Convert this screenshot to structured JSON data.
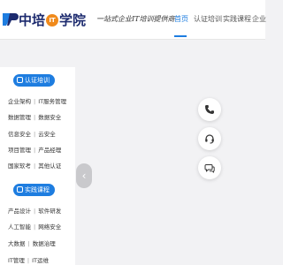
{
  "header": {
    "brand": {
      "part1": "中培",
      "badge": "IT",
      "part2": "学院"
    },
    "slogan": "一站式企业IT培训提供商",
    "nav": [
      {
        "label": "首页",
        "active": true
      },
      {
        "label": "认证培训",
        "active": false
      },
      {
        "label": "实践课程",
        "active": false
      },
      {
        "label": "企业",
        "active": false
      }
    ]
  },
  "categories": {
    "certification": {
      "title": "认证培训",
      "rows": [
        [
          "企业架构",
          "IT服务管理"
        ],
        [
          "数据管理",
          "数据安全"
        ],
        [
          "信息安全",
          "云安全"
        ],
        [
          "项目管理",
          "产品经理"
        ],
        [
          "国家软考",
          "其他认证"
        ]
      ]
    },
    "practice": {
      "title": "实践课程",
      "rows": [
        [
          "产品设计",
          "软件研发"
        ],
        [
          "人工智能",
          "网络安全"
        ],
        [
          "大数据",
          "数据治理"
        ],
        [
          "IT管理",
          "IT运维"
        ]
      ]
    }
  },
  "carousel": {
    "prev_icon": "chevron-left-icon"
  },
  "side_tools": [
    "phone-icon",
    "headset-icon",
    "chat-icon"
  ],
  "colors": {
    "accent": "#1e7de0",
    "brand_dark": "#1c2a6e",
    "badge": "#f08a1c"
  }
}
